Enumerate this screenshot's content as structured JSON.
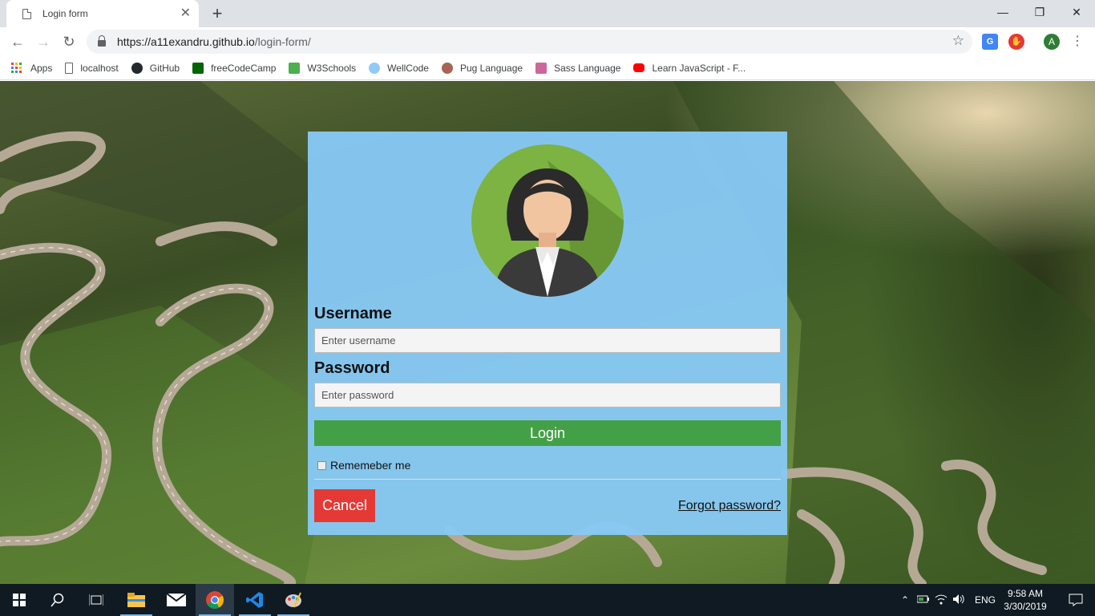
{
  "browser": {
    "tab_title": "Login form",
    "url_host": "https://a11exandru.github.io",
    "url_path": "/login-form/",
    "profile_initial": "A"
  },
  "bookmarks": [
    {
      "label": "Apps",
      "icon": "apps-grid-icon"
    },
    {
      "label": "localhost",
      "icon": "page-icon"
    },
    {
      "label": "GitHub",
      "icon": "github-icon"
    },
    {
      "label": "freeCodeCamp",
      "icon": "freecodecamp-icon"
    },
    {
      "label": "W3Schools",
      "icon": "w3schools-icon"
    },
    {
      "label": "WellCode",
      "icon": "wellcode-icon"
    },
    {
      "label": "Pug Language",
      "icon": "pug-icon"
    },
    {
      "label": "Sass Language",
      "icon": "sass-icon"
    },
    {
      "label": "Learn JavaScript - F...",
      "icon": "youtube-icon"
    }
  ],
  "form": {
    "username_label": "Username",
    "username_placeholder": "Enter username",
    "password_label": "Password",
    "password_placeholder": "Enter password",
    "login_label": "Login",
    "remember_label": "Rememeber me",
    "remember_checked": false,
    "cancel_label": "Cancel",
    "forgot_label": "Forgot password?"
  },
  "taskbar": {
    "language": "ENG",
    "time": "9:58 AM",
    "date": "3/30/2019"
  },
  "colors": {
    "card": "#87c9f5",
    "login_button": "#43a047",
    "cancel_button": "#e53935",
    "avatar_bg": "#7cb342"
  }
}
